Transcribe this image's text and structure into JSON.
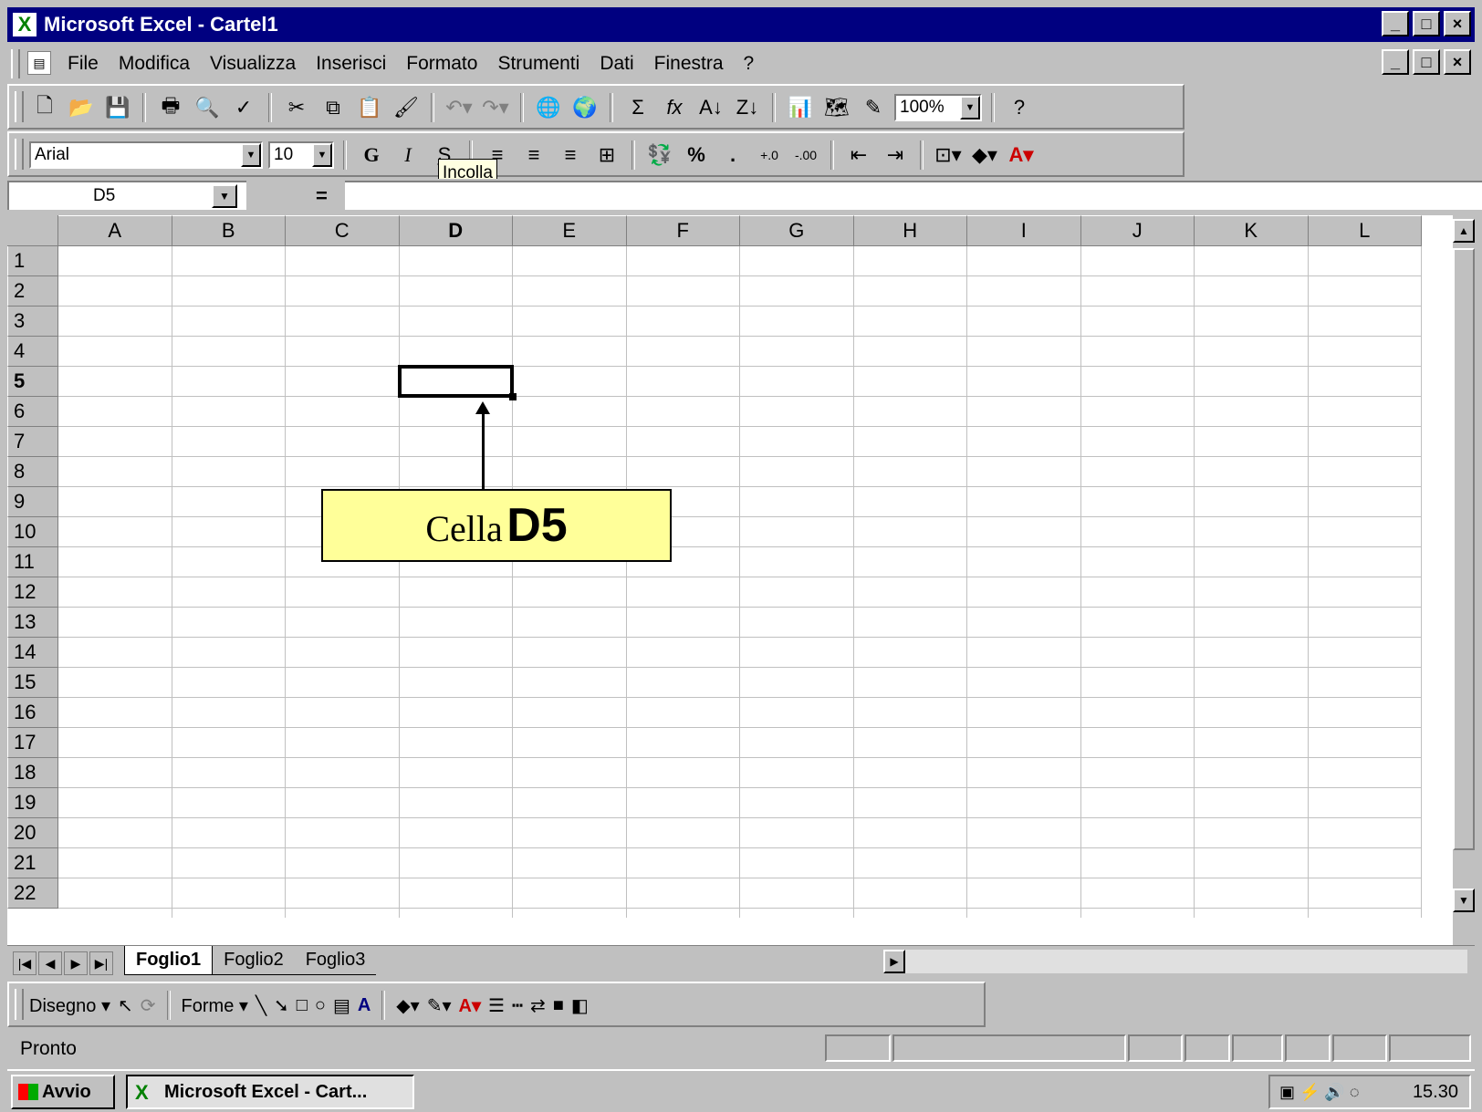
{
  "window": {
    "title": "Microsoft Excel - Cartel1",
    "min": "_",
    "max": "□",
    "close": "×"
  },
  "menu": {
    "items": [
      "File",
      "Modifica",
      "Visualizza",
      "Inserisci",
      "Formato",
      "Strumenti",
      "Dati",
      "Finestra",
      "?"
    ]
  },
  "toolbar_standard": {
    "zoom": "100%",
    "icons": [
      "new-icon",
      "open-icon",
      "save-icon",
      "print-icon",
      "print-preview-icon",
      "spelling-icon",
      "cut-icon",
      "copy-icon",
      "paste-icon",
      "format-painter-icon",
      "undo-icon",
      "redo-icon",
      "hyperlink-icon",
      "web-toolbar-icon",
      "autosum-icon",
      "function-icon",
      "sort-ascending-icon",
      "sort-descending-icon",
      "chart-wizard-icon",
      "map-icon",
      "drawing-icon",
      "help-icon"
    ]
  },
  "toolbar_format": {
    "font": "Arial",
    "size": "10",
    "bold": "G",
    "italic": "I",
    "underline": "S",
    "percent": "%",
    "comma": "."
  },
  "tooltip": "Incolla",
  "formula_bar": {
    "name_box": "D5",
    "equals": "="
  },
  "sheet": {
    "columns": [
      "A",
      "B",
      "C",
      "D",
      "E",
      "F",
      "G",
      "H",
      "I",
      "J",
      "K",
      "L"
    ],
    "rows": [
      "1",
      "2",
      "3",
      "4",
      "5",
      "6",
      "7",
      "8",
      "9",
      "10",
      "11",
      "12",
      "13",
      "14",
      "15",
      "16",
      "17",
      "18",
      "19",
      "20",
      "21",
      "22"
    ],
    "selected_col": "D",
    "selected_row": "5"
  },
  "callout": {
    "prefix": "Cella",
    "ref": "D5"
  },
  "tabs": [
    "Foglio1",
    "Foglio2",
    "Foglio3"
  ],
  "draw_toolbar": {
    "disegno": "Disegno",
    "forme": "Forme"
  },
  "status": "Pronto",
  "taskbar": {
    "start": "Avvio",
    "task": "Microsoft Excel - Cart...",
    "clock": "15.30"
  }
}
